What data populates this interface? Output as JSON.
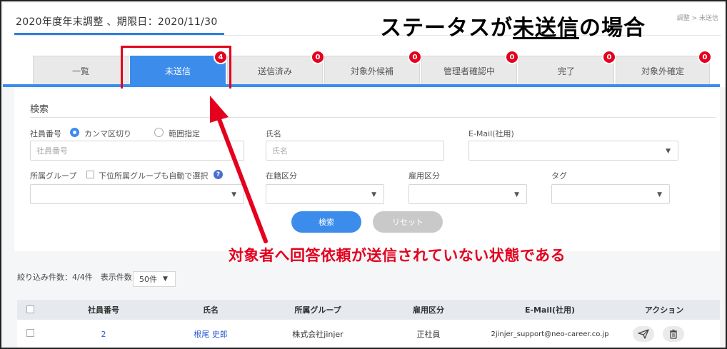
{
  "header": {
    "title": "2020年度年末調整 、期限日：2020/11/30",
    "breadcrumb": "調整 > 未送信",
    "overlay": {
      "before": "ステータスが",
      "underlined": "未送信",
      "after": "の場合"
    }
  },
  "tabs": [
    {
      "label": "一覧",
      "badge": ""
    },
    {
      "label": "未送信",
      "badge": "4"
    },
    {
      "label": "送信済み",
      "badge": "0"
    },
    {
      "label": "対象外候補",
      "badge": "0"
    },
    {
      "label": "管理者確認中",
      "badge": "0"
    },
    {
      "label": "完了",
      "badge": "0"
    },
    {
      "label": "対象外確定",
      "badge": "0"
    }
  ],
  "search": {
    "title": "検索",
    "employee_no_label": "社員番号",
    "radio_comma": "カンマ区切り",
    "radio_range": "範囲指定",
    "employee_no_placeholder": "社員番号",
    "name_label": "氏名",
    "name_placeholder": "氏名",
    "email_label": "E-Mail(社用)",
    "group_label": "所属グループ",
    "subgroup_check_label": "下位所属グループも自動で選択",
    "help_glyph": "?",
    "enrollment_label": "在籍区分",
    "employment_label": "雇用区分",
    "tag_label": "タグ",
    "caret": "▼",
    "search_button": "検索",
    "reset_button": "リセット"
  },
  "annotation": "対象者へ回答依頼が送信されていない状態である",
  "list": {
    "count_text": "絞り込み件数：4/4件　表示件数",
    "per_page": "50件",
    "columns": [
      "社員番号",
      "氏名",
      "所属グループ",
      "雇用区分",
      "E-Mail(社用)",
      "アクション"
    ],
    "rows": [
      {
        "employee_no": "2",
        "name": "根尾 史郎",
        "group": "株式会社jinjer",
        "employment": "正社員",
        "email": "2jinjer_support@neo-career.co.jp"
      }
    ]
  },
  "colors": {
    "accent": "#3c8cec",
    "badge": "#e4001e",
    "annotation": "#e4001e"
  }
}
